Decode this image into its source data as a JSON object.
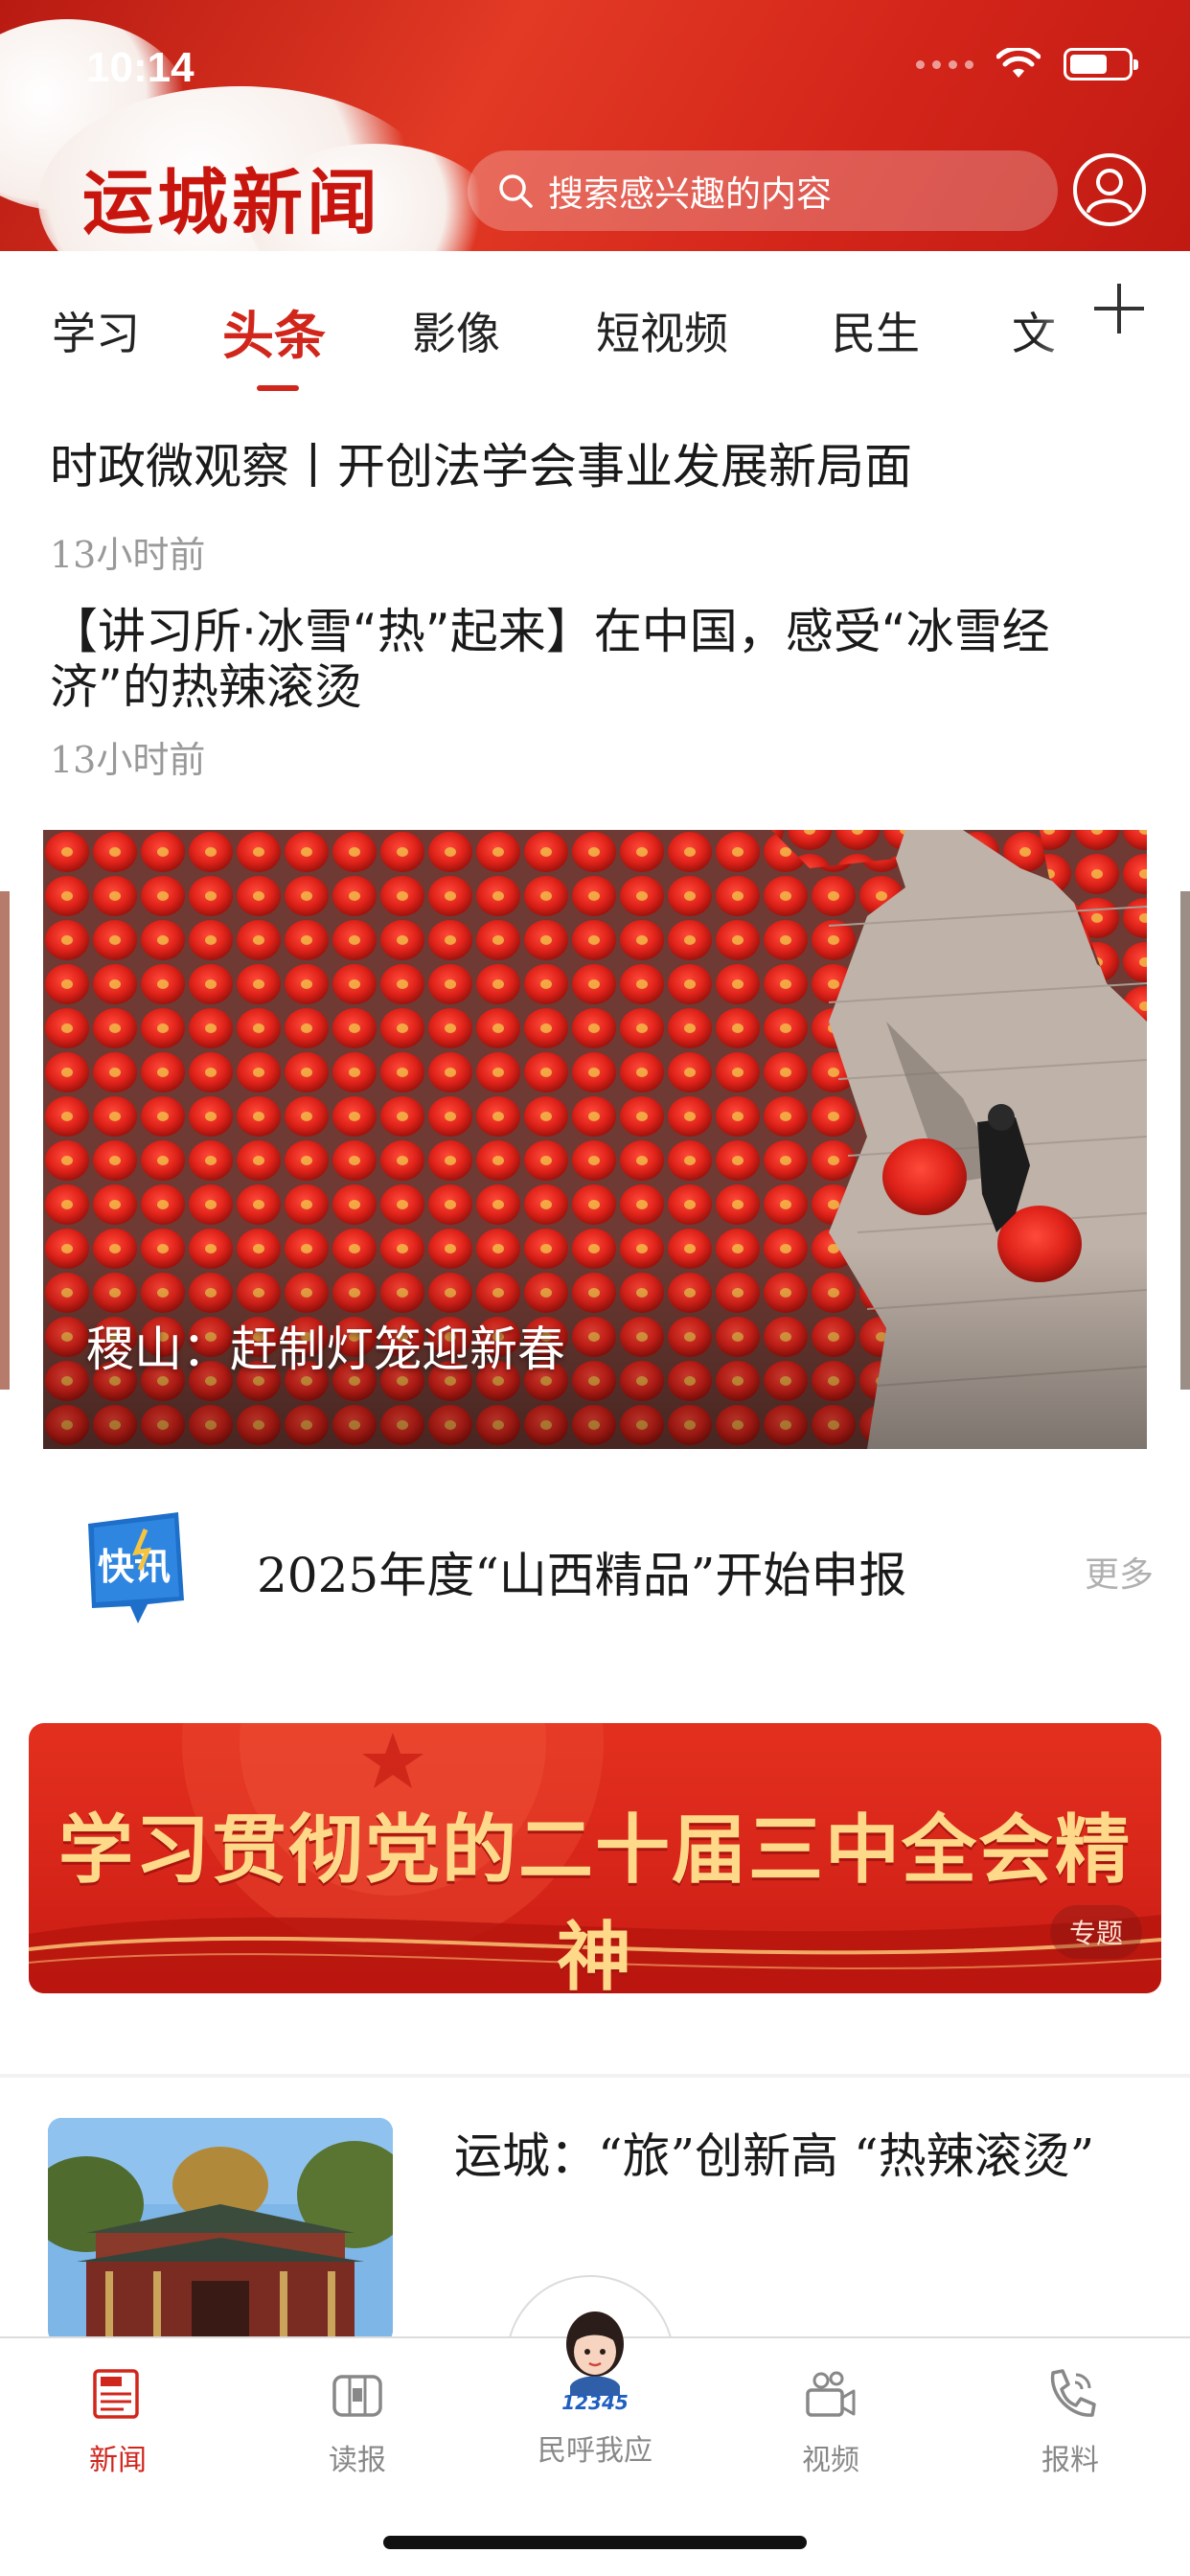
{
  "status_bar": {
    "time": "10:14"
  },
  "header": {
    "logo_text": "运城新闻",
    "search_placeholder": "搜索感兴趣的内容"
  },
  "tabs": [
    {
      "label": "学习",
      "active": false
    },
    {
      "label": "头条",
      "active": true
    },
    {
      "label": "影像",
      "active": false
    },
    {
      "label": "短视频",
      "active": false
    },
    {
      "label": "民生",
      "active": false
    },
    {
      "label": "文",
      "active": false
    }
  ],
  "news": [
    {
      "title": "时政微观察丨开创法学会事业发展新局面",
      "time": "13小时前"
    },
    {
      "title": "【讲习所·冰雪“热”起来】在中国，感受“冰雪经济”的热辣滚烫",
      "time": "13小时前"
    }
  ],
  "carousel": {
    "caption": "稷山：赶制灯笼迎新春"
  },
  "flash_news": {
    "logo_text": "快讯",
    "text": "2025年度“山西精品”开始申报",
    "more_label": "更多"
  },
  "banner": {
    "title": "学习贯彻党的二十届三中全会精神",
    "tag": "专题"
  },
  "article": {
    "title": "运城：“旅”创新高 “热辣滚烫”"
  },
  "bottom_nav": [
    {
      "label": "新闻",
      "icon": "newspaper-icon",
      "active": true
    },
    {
      "label": "读报",
      "icon": "read-paper-icon",
      "active": false
    },
    {
      "label": "民呼我应",
      "icon": "hotline-12345-avatar",
      "active": false,
      "badge_text": "12345"
    },
    {
      "label": "视频",
      "icon": "video-camera-icon",
      "active": false
    },
    {
      "label": "报料",
      "icon": "phone-report-icon",
      "active": false
    }
  ],
  "colors": {
    "brand_red": "#d1261c",
    "header_red": "#d4251a",
    "banner_gold": "#ffd98a"
  }
}
